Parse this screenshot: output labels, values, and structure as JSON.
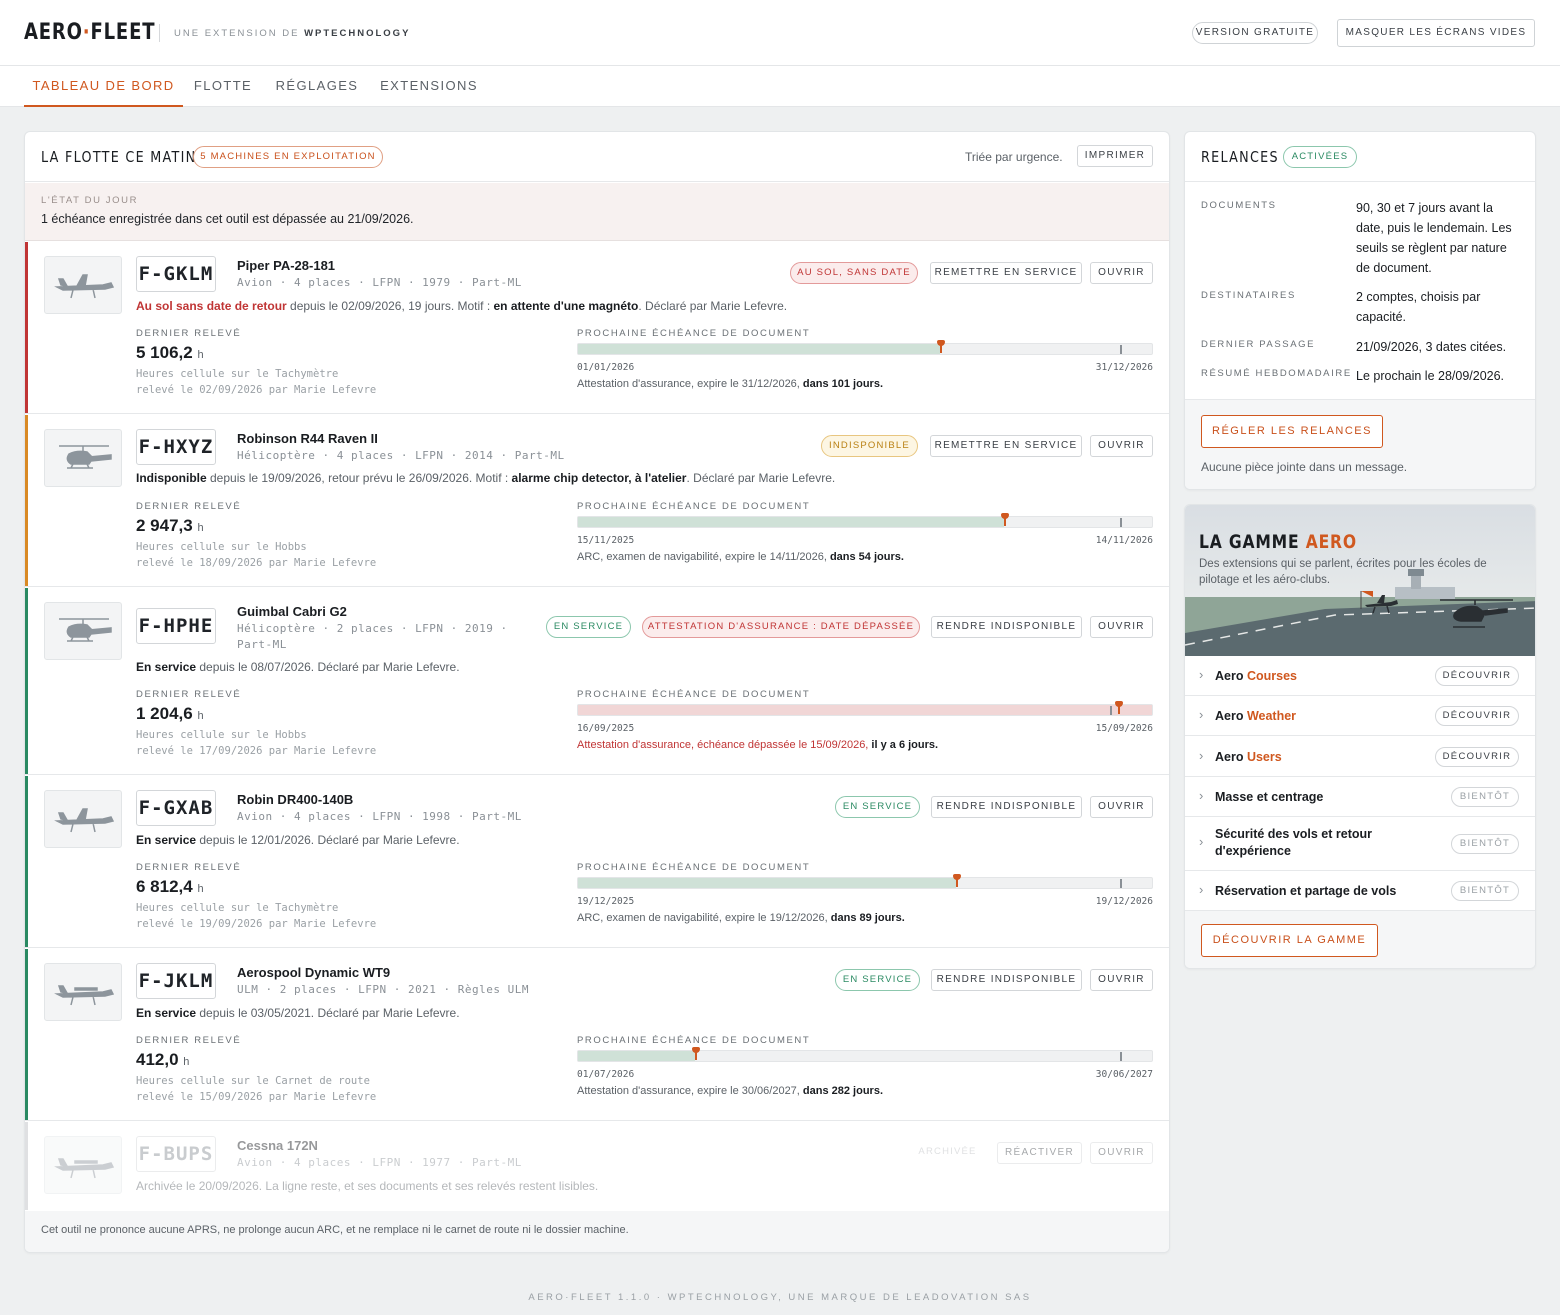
{
  "header": {
    "logo_left": "AERO",
    "logo_dot": "·",
    "logo_right": "FLEET",
    "tagline_pre": "UNE EXTENSION DE ",
    "tagline_brand": "WPTECHNOLOGY",
    "free_version": "VERSION GRATUITE",
    "hide_empty": "MASQUER LES ÉCRANS VIDES"
  },
  "tabs": [
    "TABLEAU DE BORD",
    "FLOTTE",
    "RÉGLAGES",
    "EXTENSIONS"
  ],
  "fleet": {
    "title": "LA FLOTTE CE MATIN",
    "count_badge": "5 MACHINES EN EXPLOITATION",
    "sorted": "Triée par urgence.",
    "print": "IMPRIMER",
    "state_label": "L'ÉTAT DU JOUR",
    "state_text": "1 échéance enregistrée dans cet outil est dépassée au 21/09/2026.",
    "last_reading_label": "DERNIER RELEVÉ",
    "next_doc_label": "PROCHAINE ÉCHÉANCE DE DOCUMENT",
    "footer": "Cet outil ne prononce aucune APRS, ne prolonge aucun ARC, et ne remplace ni le carnet de route ni le dossier machine."
  },
  "aircraft": [
    {
      "reg": "F-GKLM",
      "model": "Piper PA-28-181",
      "meta": "Avion · 4 places · LFPN · 1979 · Part-ML",
      "status_red": "Au sol sans date de retour",
      "status_rest": " depuis le 02/09/2026, 19 jours. Motif : ",
      "motif": "en attente d'une magnéto",
      "declared": ". Déclaré par Marie Lefevre.",
      "badge": "AU SOL, SANS DATE",
      "action": "REMETTRE EN SERVICE",
      "open": "OUVRIR",
      "hours": "5 106,2",
      "unit": "h",
      "hours_src": "Heures cellule sur le Tachymètre",
      "hours_by": "relevé le 02/09/2026 par Marie Lefevre",
      "start": "01/01/2026",
      "end": "31/12/2026",
      "progress": 0.68,
      "doc": "Attestation d'assurance, expire le 31/12/2026, ",
      "doc_b": "dans 101 jours."
    },
    {
      "reg": "F-HXYZ",
      "model": "Robinson R44 Raven II",
      "meta": "Hélicoptère · 4 places · LFPN · 2014 · Part-ML",
      "status_b": "Indisponible",
      "status_rest": " depuis le 19/09/2026, retour prévu le 26/09/2026. Motif : ",
      "motif": "alarme chip detector, à l'atelier",
      "declared": ". Déclaré par Marie Lefevre.",
      "badge": "INDISPONIBLE",
      "action": "REMETTRE EN SERVICE",
      "open": "OUVRIR",
      "hours": "2 947,3",
      "unit": "h",
      "hours_src": "Heures cellule sur le Hobbs",
      "hours_by": "relevé le 18/09/2026 par Marie Lefevre",
      "start": "15/11/2025",
      "end": "14/11/2026",
      "progress": 0.8,
      "doc": "ARC, examen de navigabilité, expire le 14/11/2026, ",
      "doc_b": "dans 54 jours."
    },
    {
      "reg": "F-HPHE",
      "model": "Guimbal Cabri G2",
      "meta": "Hélicoptère · 2 places · LFPN · 2019 ·",
      "meta2": "Part-ML",
      "status_b": "En service",
      "status_rest": " depuis le 08/07/2026. Déclaré par Marie Lefevre.",
      "badge": "EN SERVICE",
      "badge2": "ATTESTATION D'ASSURANCE : DATE DÉPASSÉE",
      "action": "RENDRE INDISPONIBLE",
      "open": "OUVRIR",
      "hours": "1 204,6",
      "unit": "h",
      "hours_src": "Heures cellule sur le Hobbs",
      "hours_by": "relevé le 17/09/2026 par Marie Lefevre",
      "start": "16/09/2025",
      "end": "15/09/2026",
      "progress": 1.0,
      "doc": "Attestation d'assurance, échéance dépassée le 15/09/2026, ",
      "doc_b": "il y a 6 jours."
    },
    {
      "reg": "F-GXAB",
      "model": "Robin DR400-140B",
      "meta": "Avion · 4 places · LFPN · 1998 · Part-ML",
      "status_b": "En service",
      "status_rest": " depuis le 12/01/2026. Déclaré par Marie Lefevre.",
      "badge": "EN SERVICE",
      "action": "RENDRE INDISPONIBLE",
      "open": "OUVRIR",
      "hours": "6 812,4",
      "unit": "h",
      "hours_src": "Heures cellule sur le Tachymètre",
      "hours_by": "relevé le 19/09/2026 par Marie Lefevre",
      "start": "19/12/2025",
      "end": "19/12/2026",
      "progress": 0.71,
      "doc": "ARC, examen de navigabilité, expire le 19/12/2026, ",
      "doc_b": "dans 89 jours."
    },
    {
      "reg": "F-JKLM",
      "model": "Aerospool Dynamic WT9",
      "meta": "ULM · 2 places · LFPN · 2021 · Règles ULM",
      "status_b": "En service",
      "status_rest": " depuis le 03/05/2021. Déclaré par Marie Lefevre.",
      "badge": "EN SERVICE",
      "action": "RENDRE INDISPONIBLE",
      "open": "OUVRIR",
      "hours": "412,0",
      "unit": "h",
      "hours_src": "Heures cellule sur le Carnet de route",
      "hours_by": "relevé le 15/09/2026 par Marie Lefevre",
      "start": "01/07/2026",
      "end": "30/06/2027",
      "progress": 0.22,
      "doc": "Attestation d'assurance, expire le 30/06/2027, ",
      "doc_b": "dans 282 jours."
    },
    {
      "reg": "F-BUPS",
      "model": "Cessna 172N",
      "meta": "Avion · 4 places · LFPN · 1977 · Part-ML",
      "status_rest": "Archivée le 20/09/2026. La ligne reste, et ses documents et ses relevés restent lisibles.",
      "badge": "ARCHIVÉE",
      "action": "RÉACTIVER",
      "open": "OUVRIR"
    }
  ],
  "reminders": {
    "title": "RELANCES",
    "badge": "ACTIVÉES",
    "rows": [
      {
        "label": "DOCUMENTS",
        "value": "90, 30 et 7 jours avant la date, puis le lendemain. Les seuils se règlent par nature de document."
      },
      {
        "label": "DESTINATAIRES",
        "value": "2 comptes, choisis par capacité."
      },
      {
        "label": "DERNIER PASSAGE",
        "value": "21/09/2026, 3 dates citées."
      },
      {
        "label": "RÉSUMÉ HEBDOMADAIRE",
        "value": "Le prochain le 28/09/2026."
      }
    ],
    "button": "RÉGLER LES RELANCES",
    "note": "Aucune pièce jointe dans un message."
  },
  "gamme": {
    "title_a": "LA GAMME ",
    "title_b": "AERO",
    "desc": "Des extensions qui se parlent, écrites pour les écoles de pilotage et les aéro-clubs.",
    "items": [
      {
        "name": "Aero ",
        "accent": "Courses",
        "btn": "DÉCOUVRIR"
      },
      {
        "name": "Aero ",
        "accent": "Weather",
        "btn": "DÉCOUVRIR"
      },
      {
        "name": "Aero ",
        "accent": "Users",
        "btn": "DÉCOUVRIR"
      },
      {
        "name": "Masse et centrage",
        "accent": "",
        "btn": "BIENTÔT"
      },
      {
        "name": "Sécurité des vols et retour d'expérience",
        "accent": "",
        "btn": "BIENTÔT"
      },
      {
        "name": "Réservation et partage de vols",
        "accent": "",
        "btn": "BIENTÔT"
      }
    ],
    "button": "DÉCOUVRIR LA GAMME"
  },
  "credit": "AERO·FLEET 1.1.0 · WPTECHNOLOGY, UNE MARQUE DE LEADOVATION SAS",
  "colors": {
    "accent": "#d0581f",
    "ok": "#2a8a62",
    "danger": "#c03535",
    "warn": "#d98a25"
  }
}
